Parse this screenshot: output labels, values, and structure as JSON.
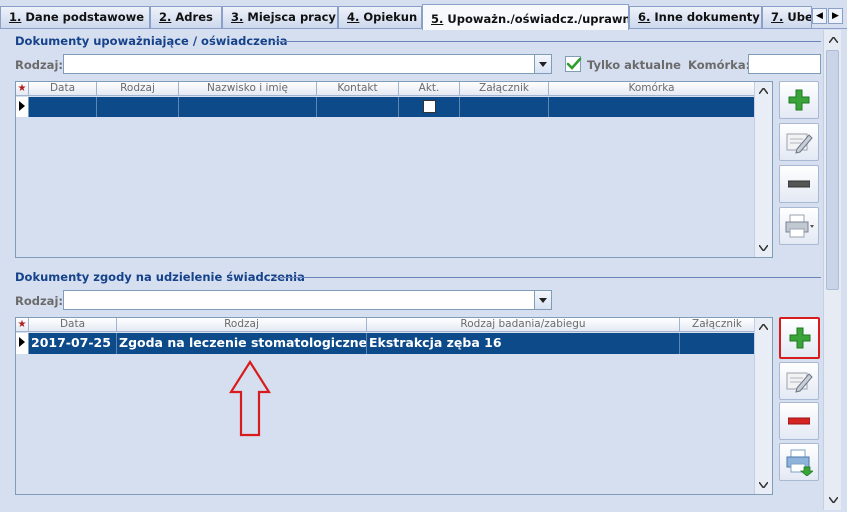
{
  "tabs": [
    {
      "num": "1.",
      "label": "Dane podstawowe"
    },
    {
      "num": "2.",
      "label": "Adres"
    },
    {
      "num": "3.",
      "label": "Miejsca pracy"
    },
    {
      "num": "4.",
      "label": "Opiekun"
    },
    {
      "num": "5.",
      "label": "Upoważn./oświadcz./uprawn."
    },
    {
      "num": "6.",
      "label": "Inne dokumenty"
    },
    {
      "num": "7.",
      "label": "Ubez"
    }
  ],
  "section1": {
    "title": "Dokumenty upoważniające / oświadczenia",
    "rodzaj_label": "Rodzaj:",
    "rodzaj_value": "",
    "tylko_aktualne_label": "Tylko aktualne",
    "tylko_aktualne_checked": true,
    "komorka_label": "Komórka:",
    "komorka_value": "",
    "columns": [
      "★",
      "Data",
      "Rodzaj",
      "Nazwisko i imię",
      "Kontakt",
      "Akt.",
      "Załącznik",
      "Komórka"
    ],
    "rows": [
      {
        "data": "",
        "rodzaj": "",
        "nazwisko": "",
        "kontakt": "",
        "akt": false,
        "zalacznik": "",
        "komorka": ""
      }
    ]
  },
  "section2": {
    "title": "Dokumenty zgody na udzielenie świadczenia",
    "rodzaj_label": "Rodzaj:",
    "rodzaj_value": "",
    "columns": [
      "★",
      "Data",
      "Rodzaj",
      "Rodzaj badania/zabiegu",
      "Załącznik"
    ],
    "rows": [
      {
        "data": "2017-07-25",
        "rodzaj": "Zgoda na leczenie stomatologiczne",
        "badanie": "Ekstrakcja zęba 16",
        "zalacznik": ""
      }
    ]
  },
  "icons": {
    "add": "plus-icon",
    "edit": "edit-icon",
    "remove": "minus-icon",
    "print": "printer-icon"
  },
  "colors": {
    "selected_row": "#0c4a8a",
    "add_green": "#3aa33a",
    "highlight_red": "#d81c1c"
  }
}
